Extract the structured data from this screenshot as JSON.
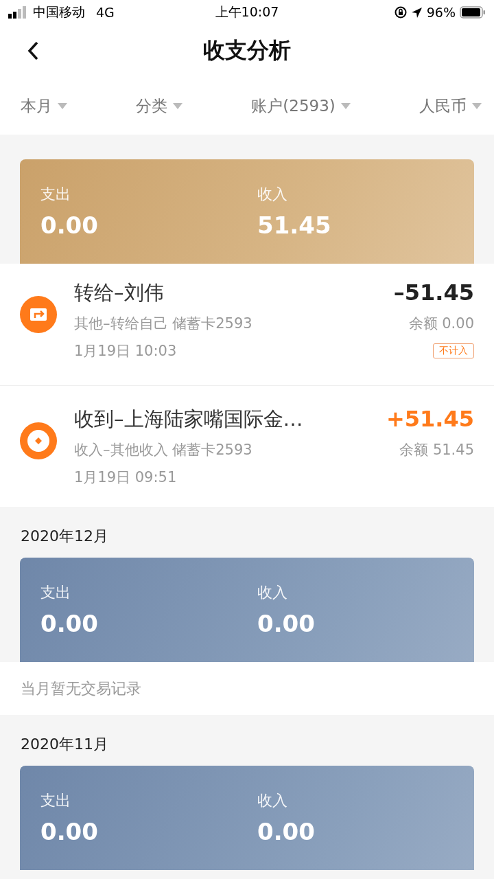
{
  "status_bar": {
    "carrier": "中国移动",
    "network": "4G",
    "time": "上午10:07",
    "battery": "96%"
  },
  "nav": {
    "title": "收支分析"
  },
  "filters": [
    {
      "label": "本月"
    },
    {
      "label": "分类"
    },
    {
      "label": "账户(2593)"
    },
    {
      "label": "人民币"
    }
  ],
  "sections": [
    {
      "kind": "current",
      "summary": {
        "expense_label": "支出",
        "expense": "0.00",
        "income_label": "收入",
        "income": "51.45"
      },
      "transactions": [
        {
          "kind": "transfer",
          "title": "转给–刘伟",
          "subtitle": "其他–转给自己 储蓄卡2593",
          "time": "1月19日 10:03",
          "amount": "–51.45",
          "balance": "余额 0.00",
          "tag": "不计入"
        },
        {
          "kind": "income",
          "title": "收到–上海陆家嘴国际金…",
          "subtitle": "收入–其他收入 储蓄卡2593",
          "time": "1月19日 09:51",
          "amount": "+51.45",
          "balance": "余额 51.45"
        }
      ]
    },
    {
      "kind": "past",
      "header": "2020年12月",
      "summary": {
        "expense_label": "支出",
        "expense": "0.00",
        "income_label": "收入",
        "income": "0.00"
      },
      "empty_text": "当月暂无交易记录"
    },
    {
      "kind": "past",
      "header": "2020年11月",
      "summary": {
        "expense_label": "支出",
        "expense": "0.00",
        "income_label": "收入",
        "income": "0.00"
      }
    }
  ]
}
